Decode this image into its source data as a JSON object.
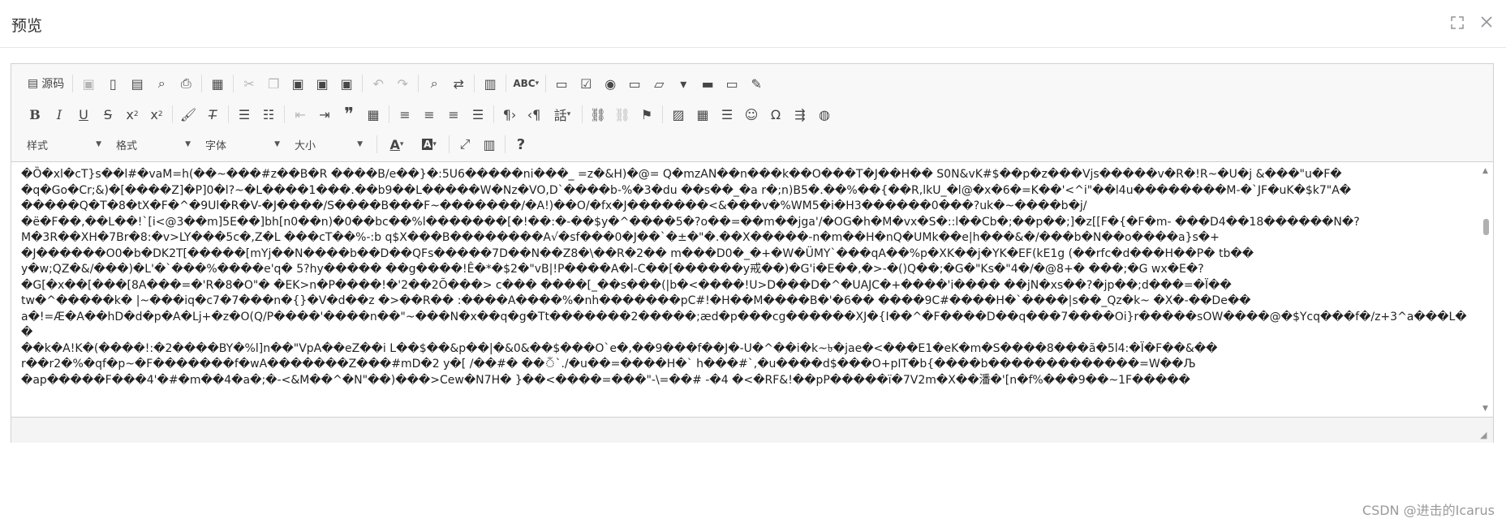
{
  "dialog": {
    "title": "预览"
  },
  "toolbar": {
    "source_label": "源码",
    "styles_label": "样式",
    "format_label": "格式",
    "font_label": "字体",
    "size_label": "大小"
  },
  "content": {
    "lines": [
      "�Ȍ�xl�cT}s��l#�vaM=h(��~���#z��B�R ����B/e��}�:5U6�����ni���_ =z�&H)�@= Q�mzAN��n���k��O���T�J��H�� S0N&vK#$��p�z���Vjs�����v�R�!R~�U�j &���\"u�F�",
      "�q�Go�Cr;&)�[����Z]�P]0�l?~�L����1���.��b9��L�����W�Nz�VO,D`����b-%�3�du ��s��_�a r�;n)B5�.��%��{��R,lkU_�l@�x�6�=K��'<^i\"��l4u��������M-�`JF�uK�$k7\"A�",
      "�����Q�T�8�tX�F�^�9Ul�R�V-�J����/S����B���F~�������/�A!)��O/�fx�J�������<&���v�%WM5�i�H3������0���?uk�~����b�j/",
      "�ë�F��,��L��!`[i<@3��m]5E��]bh[n0��n)�0��bc��%l�������[�!��:�-��$y�^����5�?o��=��m��jga'/�OG�h�M�vx�S�::l��Cb�;��p��;]�z[[F�{�F�m- ���D4��18������N�?",
      "M�3R��XH�7Br�8:�v>LY���5c�,Z�L ���cT��%-:b q$X���B��������A√�sf���0�J��`�±�\"�.��X�����-n�m��H�nQ�UMk��e|h���&�/���b�N��o����a}s�+",
      "�J������O0�b�DK2T[�����[mYj��N����b��D��QFs�����7D��N��Z8�\\��R�2�� m���D0�_�+�W�ÜMY`���qA��%p�XK��j�YK�EF(kE1g (��rfc�d���H��P� tb��",
      "y�w;QZ�&/���)�L'�`���%����e'q� 5?hy����� ��g����!Ê�*�$2�\"vB|!P����A�l-C��[������y戒��)�G'i�E��,�>-�()Q��;�G�\"Ks�\"4�/�@8+� ���;�G wx�E�?",
      "�G[�x��[���[8A���=�'R�8�O\"� �EK>n�P����!�'2��2Õ���> c��� ����[_��s���(|b�<����!U>D���D�^�UAJC�+����'i���� ��jN�xs��?�jp��;d���=�Ï��",
      "tw�^�����k� |~���iq�c7�7���n�{}�V�d��z �>��R�� :����A����%�nh�������pC#!�H��M����B�'�6�� ����9C#����H�`����|s��_Qz�k~ �X�-��De��",
      "a�!=Æ�A��hD�d�p�A�Lj+�z�O(Q/P����'����n��\"~���N�x��q�g�Tt�������2�����;æd�p���cg������XJ�{I��^�F����D��q���7����Oi}r�����sOW����@�$Ycq���f�/z+3^a���L��",
      "��k�A!K�(����!:�2����BY�%l]n��\"VpA��eZ��i L��$��&p��|�&0&��$���O`e�,��9���f��J�-U�^��i�k~৳�jae�<���E1�eK�m�S����8���ã�5l4:�Ï�F��&��",
      "r��r2�%�qf�p~�F�������f�wA�������Z���#mD�2 y�[ /��#� ��ঁ`./�u��=����H�` h���#`,�u����d$���O+pIT�b{����b�������������=W��Љ",
      "�ap�����F���4'�#�m��4�a�;�-<&M��^�N\"��)���>Cew�N7H� }��<����=���\"-\\=��# -�4 �<�RF&!��pP�����ï�7V2m�X��潘�'[n�f%���9��~1F�����"
    ]
  }
}
